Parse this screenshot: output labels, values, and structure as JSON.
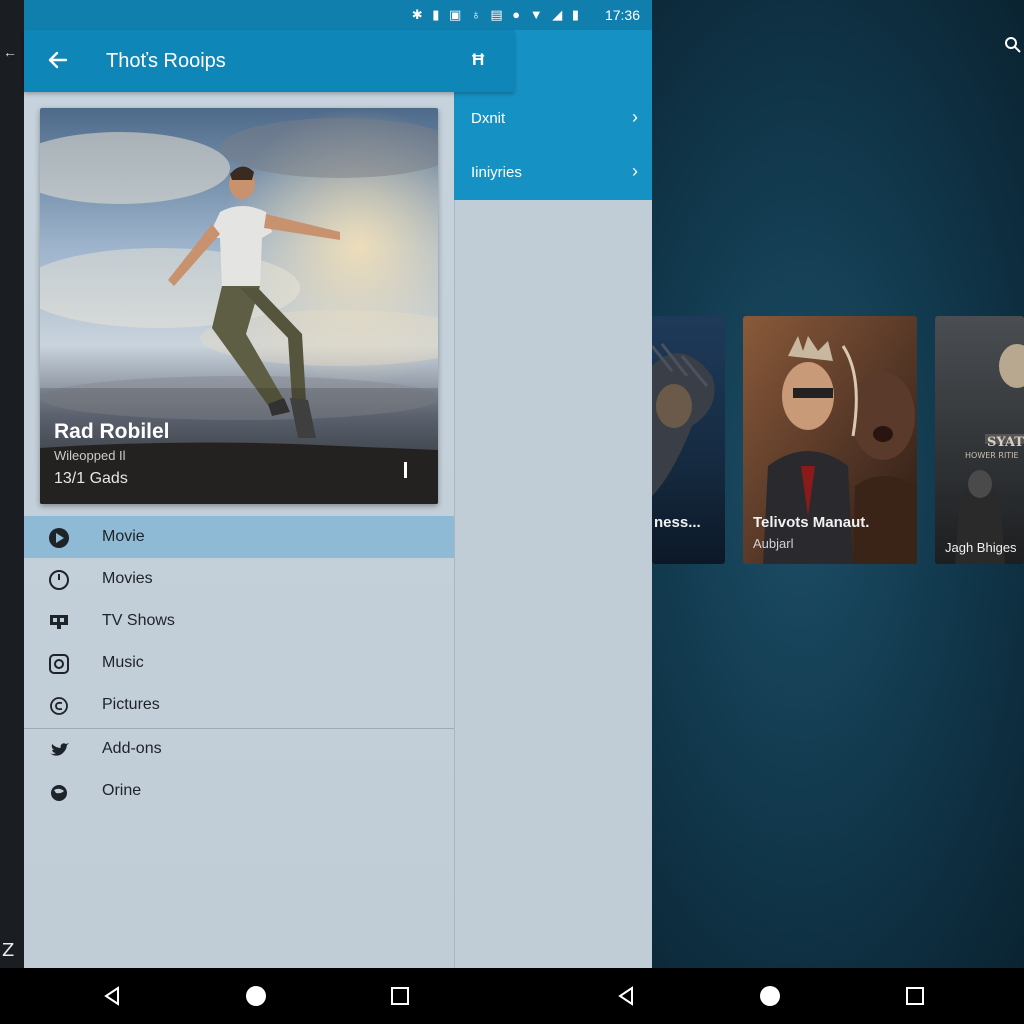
{
  "status": {
    "time": "17:36",
    "icons": [
      "bluetooth-icon",
      "signal-icon",
      "sync-icon",
      "location-icon",
      "sd-icon",
      "alarm-icon",
      "wifi-icon",
      "signal-full-icon",
      "battery-icon"
    ]
  },
  "left": {
    "back_glyph": "←",
    "bottom_glyph": "Z"
  },
  "appbar": {
    "title": "Thoťs Rooips",
    "action": "Ħ"
  },
  "subpanel": {
    "items": [
      {
        "label": "Dxnit",
        "chevron": "›"
      },
      {
        "label": "Iiniyries",
        "chevron": "›"
      }
    ]
  },
  "hero": {
    "title": "Rad Robilel",
    "subtitle": "Wileopped Il",
    "count": "13/1 Gads"
  },
  "nav": {
    "items": [
      {
        "label": "Movie",
        "icon": "play-circle-icon",
        "active": true
      },
      {
        "label": "Movies",
        "icon": "clock-icon"
      },
      {
        "label": "TV Shows",
        "icon": "tv-icon"
      },
      {
        "label": "Music",
        "icon": "music-icon"
      },
      {
        "label": "Pictures",
        "icon": "pictures-icon"
      },
      {
        "label": "Add-ons",
        "icon": "bird-icon"
      },
      {
        "label": "Orine",
        "icon": "globe-icon"
      }
    ]
  },
  "posters": [
    {
      "label": "ness..."
    },
    {
      "label": "Telivots Manaut.",
      "sub": "Aubjarl"
    },
    {
      "label": "Jagh Bhiges"
    }
  ],
  "colors": {
    "appbar": "#0f86b8",
    "subpanel": "#1691c4",
    "drawer": "#c2ced8",
    "active": "#8fbad5"
  }
}
